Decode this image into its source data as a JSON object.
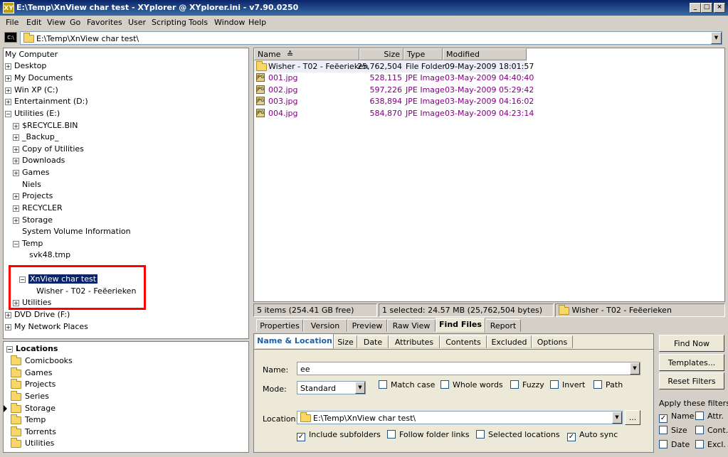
{
  "window": {
    "title": "E:\\Temp\\XnView char test - XYplorer @ XYplorer.ini - v7.90.0250",
    "app_icon": "XY",
    "min_label": "_",
    "max_label": "□",
    "close_label": "×"
  },
  "menu": [
    "File",
    "Edit",
    "View",
    "Go",
    "Favorites",
    "User",
    "Scripting",
    "Tools",
    "Window",
    "Help"
  ],
  "address": {
    "cmd_label": "C:\\",
    "path": "E:\\Temp\\XnView char test\\"
  },
  "tree": {
    "root": "My Computer",
    "nodes": [
      {
        "label": "Desktop",
        "pm": "+"
      },
      {
        "label": "My Documents",
        "pm": "+"
      },
      {
        "label": "Win XP (C:)",
        "pm": "+"
      },
      {
        "label": "Entertainment (D:)",
        "pm": "+"
      },
      {
        "label": "Utilities (E:)",
        "pm": "−"
      },
      {
        "label": "$RECYCLE.BIN",
        "pm": "+"
      },
      {
        "label": "_Backup_",
        "pm": "+"
      },
      {
        "label": "Copy of Utilities",
        "pm": "+"
      },
      {
        "label": "Downloads",
        "pm": "+"
      },
      {
        "label": "Games",
        "pm": "+"
      },
      {
        "label": "Niels",
        "pm": ""
      },
      {
        "label": "Projects",
        "pm": "+"
      },
      {
        "label": "RECYCLER",
        "pm": "+"
      },
      {
        "label": "Storage",
        "pm": "+"
      },
      {
        "label": "System Volume Information",
        "pm": ""
      },
      {
        "label": "Temp",
        "pm": "−"
      },
      {
        "label": "svk48.tmp",
        "pm": ""
      },
      {
        "label": "XnView char test",
        "pm": "−"
      },
      {
        "label": "Wisher - T02 - Feëerieken",
        "pm": ""
      },
      {
        "label": "Utilities",
        "pm": "+"
      },
      {
        "label": "DVD Drive (F:)",
        "pm": "+"
      },
      {
        "label": "My Network Places",
        "pm": "+"
      }
    ]
  },
  "locations": {
    "header": "Locations",
    "items": [
      "Comicbooks",
      "Games",
      "Projects",
      "Series",
      "Storage",
      "Temp",
      "Torrents",
      "Utilities"
    ]
  },
  "filelist": {
    "columns": [
      "Name",
      "Size",
      "Type",
      "Modified"
    ],
    "sort_arrow": "≙",
    "rows": [
      {
        "name": "Wisher - T02 - Feëerieken",
        "size": "25,762,504",
        "type": "File Folder",
        "modified": "09-May-2009 18:01:57"
      },
      {
        "name": "001.jpg",
        "size": "528,115",
        "type": "JPE Image",
        "modified": "03-May-2009 04:40:40"
      },
      {
        "name": "002.jpg",
        "size": "597,226",
        "type": "JPE Image",
        "modified": "03-May-2009 05:29:42"
      },
      {
        "name": "003.jpg",
        "size": "638,894",
        "type": "JPE Image",
        "modified": "03-May-2009 04:16:02"
      },
      {
        "name": "004.jpg",
        "size": "584,870",
        "type": "JPE Image",
        "modified": "03-May-2009 04:23:14"
      }
    ],
    "jpg_icon_text": "JPG"
  },
  "status": {
    "items": "5 items (254.41 GB free)",
    "selected": "1 selected: 24.57 MB (25,762,504 bytes)",
    "current": "Wisher - T02 - Feëerieken"
  },
  "info_tabs": [
    "Properties",
    "Version",
    "Preview",
    "Raw View",
    "Find Files",
    "Report"
  ],
  "find": {
    "tabs": [
      "Name & Location",
      "Size",
      "Date",
      "Attributes",
      "Contents",
      "Excluded",
      "Options"
    ],
    "name_label": "Name:",
    "name_value": "ee",
    "mode_label": "Mode:",
    "mode_value": "Standard",
    "match_case": "Match case",
    "whole_words": "Whole words",
    "fuzzy": "Fuzzy",
    "invert": "Invert",
    "path": "Path",
    "location_label": "Location:",
    "location_value": "E:\\Temp\\XnView char test\\",
    "browse_label": "...",
    "include_subfolders": "Include subfolders",
    "follow_links": "Follow folder links",
    "selected_locations": "Selected locations",
    "auto_sync": "Auto sync",
    "find_now": "Find Now",
    "templates": "Templates...",
    "reset_filters": "Reset Filters",
    "apply_filters": "Apply these filters:",
    "f_name": "Name",
    "f_attr": "Attr.",
    "f_size": "Size",
    "f_cont": "Cont.",
    "f_date": "Date",
    "f_excl": "Excl."
  },
  "check_mark": "✓",
  "colors": {
    "title_bar": "#0a246a",
    "selection": "#0a246a",
    "highlight_box": "#ff0000",
    "image_files": "#800080"
  }
}
